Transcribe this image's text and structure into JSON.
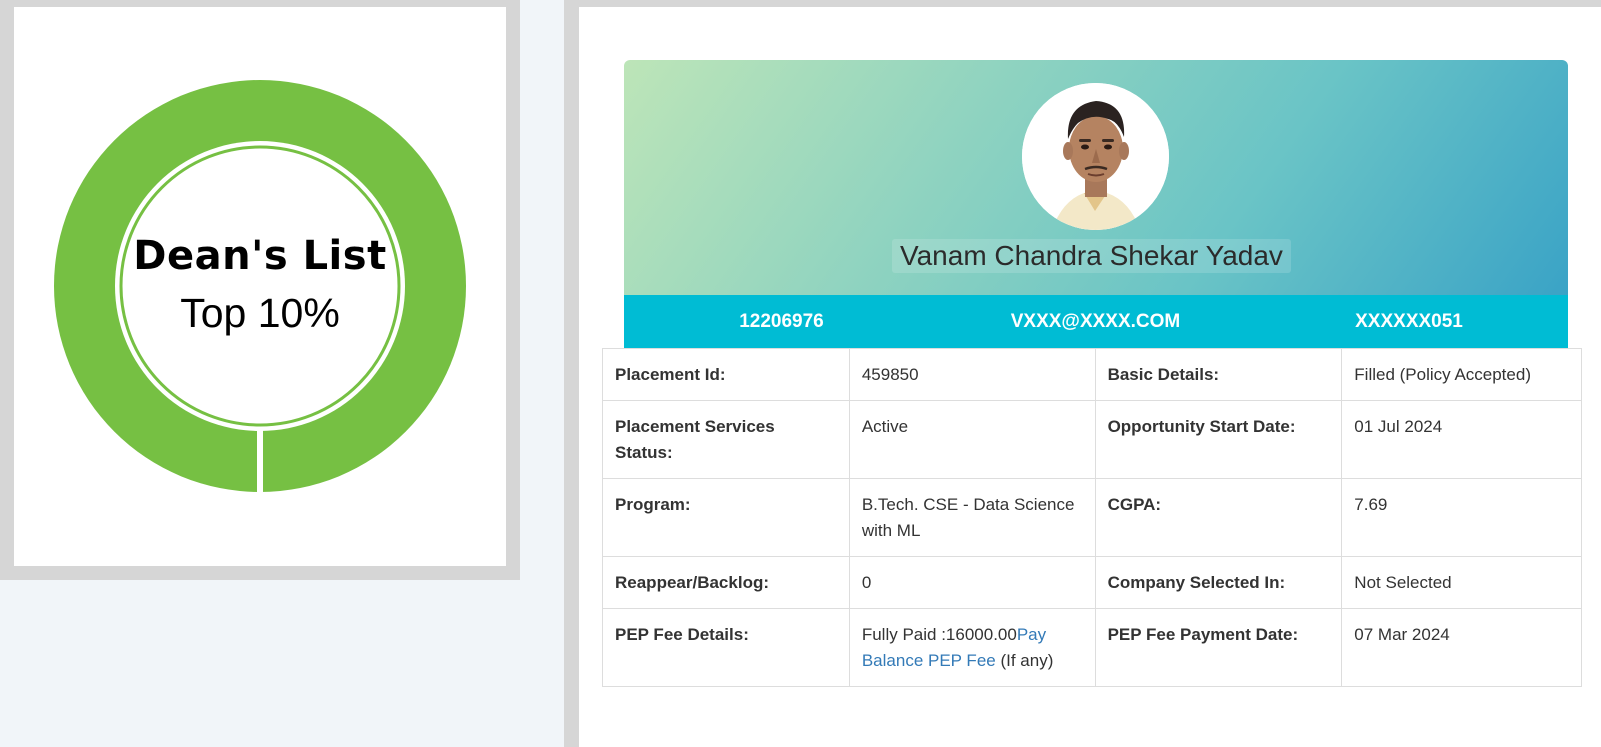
{
  "badge": {
    "title": "Dean's List",
    "subtitle": "Top 10%",
    "ring_color": "#76c043"
  },
  "profile": {
    "name": "Vanam Chandra Shekar Yadav",
    "avatar_icon": "student-photo",
    "reg_no": "12206976",
    "email": "VXXX@XXXX.COM",
    "phone": "XXXXXX051",
    "info_bar_color": "#00bcd4"
  },
  "details": {
    "rows": [
      {
        "label1": "Placement Id:",
        "value1": "459850",
        "label2": "Basic Details:",
        "value2": "Filled (Policy Accepted)"
      },
      {
        "label1": "Placement Services Status:",
        "value1": "Active",
        "label2": "Opportunity Start Date:",
        "value2": "01 Jul 2024"
      },
      {
        "label1": "Program:",
        "value1": "B.Tech. CSE - Data Science with ML",
        "label2": "CGPA:",
        "value2": "7.69"
      },
      {
        "label1": "Reappear/Backlog:",
        "value1": "0",
        "label2": "Company Selected In:",
        "value2": "Not Selected"
      }
    ],
    "pep": {
      "label1": "PEP Fee Details:",
      "fee_text": "Fully Paid :16000.00",
      "pay_link": "Pay Balance PEP Fee",
      "if_any": " (If any)",
      "label2": "PEP Fee Payment Date:",
      "value2": "07 Mar 2024"
    }
  }
}
